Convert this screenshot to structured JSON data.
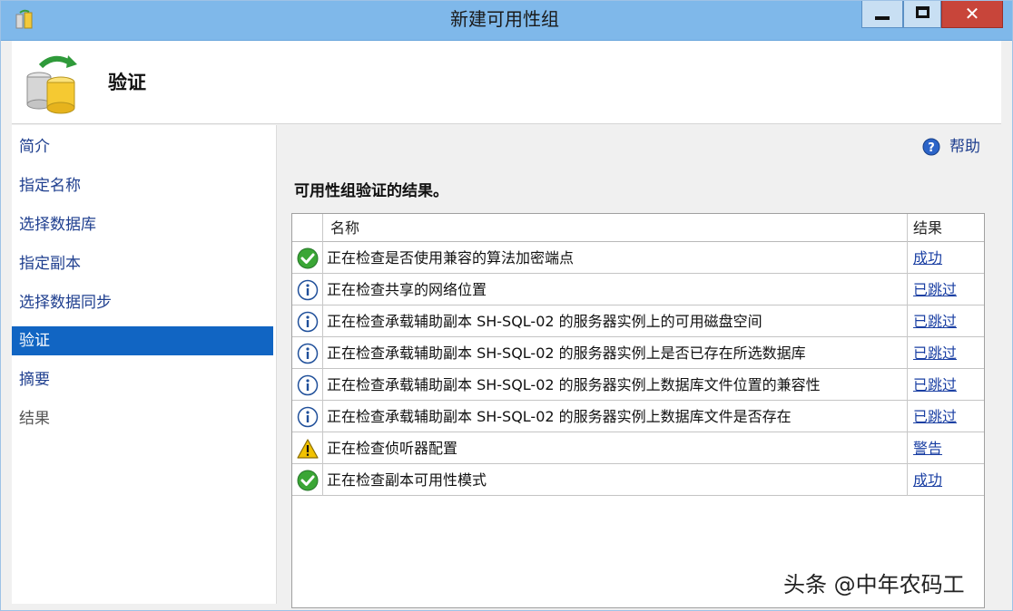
{
  "window": {
    "title": "新建可用性组",
    "close_glyph": "✕"
  },
  "header": {
    "title": "验证",
    "icon": "database-icon"
  },
  "sidebar": {
    "items": [
      {
        "label": "简介",
        "state": "normal"
      },
      {
        "label": "指定名称",
        "state": "normal"
      },
      {
        "label": "选择数据库",
        "state": "normal"
      },
      {
        "label": "指定副本",
        "state": "normal"
      },
      {
        "label": "选择数据同步",
        "state": "normal"
      },
      {
        "label": "验证",
        "state": "active"
      },
      {
        "label": "摘要",
        "state": "normal"
      },
      {
        "label": "结果",
        "state": "disabled"
      }
    ]
  },
  "main": {
    "help_label": "帮助",
    "section_title": "可用性组验证的结果。",
    "columns": {
      "name": "名称",
      "result": "结果"
    },
    "rows": [
      {
        "status": "success",
        "name": "正在检查是否使用兼容的算法加密端点",
        "result": "成功"
      },
      {
        "status": "info",
        "name": "正在检查共享的网络位置",
        "result": "已跳过"
      },
      {
        "status": "info",
        "name": "正在检查承载辅助副本 SH-SQL-02 的服务器实例上的可用磁盘空间",
        "result": "已跳过"
      },
      {
        "status": "info",
        "name": "正在检查承载辅助副本 SH-SQL-02 的服务器实例上是否已存在所选数据库",
        "result": "已跳过"
      },
      {
        "status": "info",
        "name": "正在检查承载辅助副本 SH-SQL-02 的服务器实例上数据库文件位置的兼容性",
        "result": "已跳过"
      },
      {
        "status": "info",
        "name": "正在检查承载辅助副本 SH-SQL-02 的服务器实例上数据库文件是否存在",
        "result": "已跳过"
      },
      {
        "status": "warning",
        "name": "正在检查侦听器配置",
        "result": "警告"
      },
      {
        "status": "success",
        "name": "正在检查副本可用性模式",
        "result": "成功"
      }
    ]
  },
  "watermark": "头条 @中年农码工",
  "colors": {
    "titlebar": "#7fb8ea",
    "active_nav": "#1165c3",
    "link": "#1a3fa3",
    "success": "#3aa635",
    "info": "#1f4f9a",
    "warning": "#f2c200"
  }
}
